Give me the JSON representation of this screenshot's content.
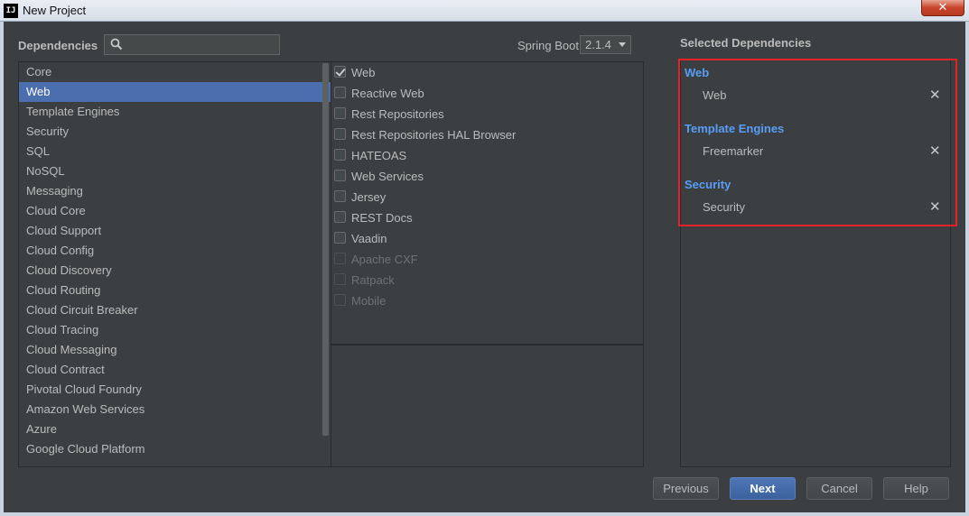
{
  "window": {
    "title": "New Project",
    "app_icon": "IJ",
    "close_glyph": "✕"
  },
  "dependencies_label": "Dependencies",
  "search": {
    "value": "",
    "placeholder": ""
  },
  "spring_boot": {
    "label": "Spring Boot",
    "selected": "2.1.4"
  },
  "categories": [
    {
      "label": "Core",
      "selected": false
    },
    {
      "label": "Web",
      "selected": true
    },
    {
      "label": "Template Engines",
      "selected": false
    },
    {
      "label": "Security",
      "selected": false
    },
    {
      "label": "SQL",
      "selected": false
    },
    {
      "label": "NoSQL",
      "selected": false
    },
    {
      "label": "Messaging",
      "selected": false
    },
    {
      "label": "Cloud Core",
      "selected": false
    },
    {
      "label": "Cloud Support",
      "selected": false
    },
    {
      "label": "Cloud Config",
      "selected": false
    },
    {
      "label": "Cloud Discovery",
      "selected": false
    },
    {
      "label": "Cloud Routing",
      "selected": false
    },
    {
      "label": "Cloud Circuit Breaker",
      "selected": false
    },
    {
      "label": "Cloud Tracing",
      "selected": false
    },
    {
      "label": "Cloud Messaging",
      "selected": false
    },
    {
      "label": "Cloud Contract",
      "selected": false
    },
    {
      "label": "Pivotal Cloud Foundry",
      "selected": false
    },
    {
      "label": "Amazon Web Services",
      "selected": false
    },
    {
      "label": "Azure",
      "selected": false
    },
    {
      "label": "Google Cloud Platform",
      "selected": false
    }
  ],
  "dependencies": [
    {
      "label": "Web",
      "checked": true,
      "enabled": true
    },
    {
      "label": "Reactive Web",
      "checked": false,
      "enabled": true
    },
    {
      "label": "Rest Repositories",
      "checked": false,
      "enabled": true
    },
    {
      "label": "Rest Repositories HAL Browser",
      "checked": false,
      "enabled": true
    },
    {
      "label": "HATEOAS",
      "checked": false,
      "enabled": true
    },
    {
      "label": "Web Services",
      "checked": false,
      "enabled": true
    },
    {
      "label": "Jersey",
      "checked": false,
      "enabled": true
    },
    {
      "label": "REST Docs",
      "checked": false,
      "enabled": true
    },
    {
      "label": "Vaadin",
      "checked": false,
      "enabled": true
    },
    {
      "label": "Apache CXF",
      "checked": false,
      "enabled": false
    },
    {
      "label": "Ratpack",
      "checked": false,
      "enabled": false
    },
    {
      "label": "Mobile",
      "checked": false,
      "enabled": false
    }
  ],
  "selected_label": "Selected Dependencies",
  "selected_groups": [
    {
      "group": "Web",
      "item": "Web"
    },
    {
      "group": "Template Engines",
      "item": "Freemarker"
    },
    {
      "group": "Security",
      "item": "Security"
    }
  ],
  "remove_glyph": "✕",
  "buttons": {
    "previous": "Previous",
    "next": "Next",
    "cancel": "Cancel",
    "help": "Help"
  },
  "colors": {
    "selection": "#4b6eaf",
    "group_heading": "#589df6",
    "highlight_box": "#e5212a",
    "background": "#3c3f41"
  }
}
